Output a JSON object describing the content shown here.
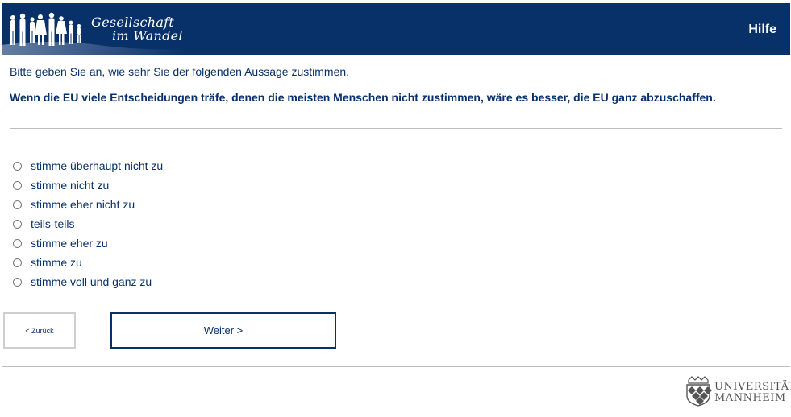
{
  "header": {
    "brand_line1": "Gesellschaft",
    "brand_line2": "im Wandel",
    "help_label": "Hilfe",
    "background_color": "#08316a"
  },
  "question": {
    "instruction": "Bitte geben Sie an, wie sehr Sie der folgenden Aussage zustimmen.",
    "statement": "Wenn die EU viele Entscheidungen träfe, denen die meisten Menschen nicht zustimmen, wäre es besser, die EU ganz abzuschaffen."
  },
  "options": [
    {
      "label": "stimme überhaupt nicht zu"
    },
    {
      "label": "stimme nicht zu"
    },
    {
      "label": "stimme eher nicht zu"
    },
    {
      "label": "teils-teils"
    },
    {
      "label": "stimme eher zu"
    },
    {
      "label": "stimme zu"
    },
    {
      "label": "stimme voll und ganz zu"
    }
  ],
  "nav": {
    "back_label": "< Zurück",
    "next_label": "Weiter >"
  },
  "footer": {
    "university_line1": "UNIVERSITÄT",
    "university_line2": "MANNHEIM"
  },
  "icons": {
    "header_logo": "people-silhouettes-icon",
    "university_crest": "university-crest-icon"
  }
}
